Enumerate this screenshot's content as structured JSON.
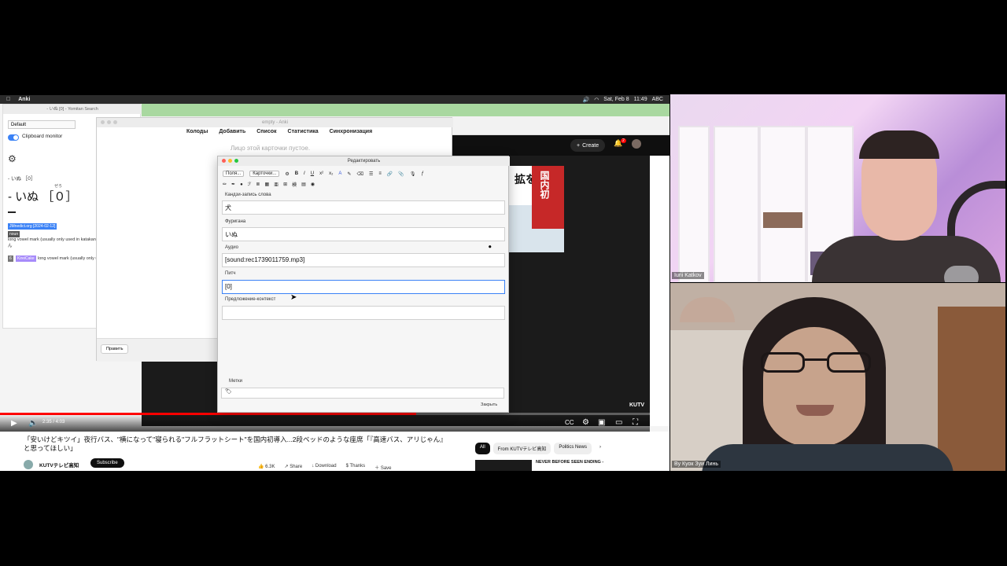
{
  "menubar": {
    "app": "Anki",
    "status_date": "Sat, Feb 8",
    "status_time": "11:49",
    "status_lang": "ABC"
  },
  "yandex": {
    "title": "- いぬ [0] - Yomitan Search",
    "profile": "Default",
    "clipboard_monitor": "Clipboard monitor",
    "small_term": "- いぬ ［0］",
    "big_term": "- いぬ  ［０］",
    "furigana": "ぜろ",
    "tag_dict": "JMnedict.org [2024-02-12]",
    "tag_pos": "noun",
    "definition1": "long vowel mark (usually only used in katakana) known as ちょうおん",
    "tag_kind": "6",
    "tag_source": "KireiCake",
    "definition2": "long vowel mark (usually only used in katakana)"
  },
  "browser": {
    "create_label": "Create",
    "notification_count": "2",
    "kutv": "KUTV",
    "thumb_text": "拡を ト",
    "thumb_text2": "国内初",
    "time": "2:35 / 4:03",
    "progress": 0.64,
    "video_title_line1": "「安いけどキツイ」夜行バス、\"横になって\"寝られる\"フルフラットシート\"を国内初導入...2段ベッドのような座席「『高速バス、アリじゃん』",
    "video_title_line2": "と思ってほしい」",
    "channel": "KUTVテレビ高知",
    "subscribe": "Subscribe",
    "likes": "6.3K",
    "share": "Share",
    "download": "Download",
    "thanks": "Thanks",
    "save": "Save",
    "chips": [
      "All",
      "From KUTVテレビ高知",
      "Politics News"
    ],
    "rec_title": "NEVER BEFORE SEEN ENDING -"
  },
  "anki": {
    "title": "empty - Anki",
    "nav": [
      "Колоды",
      "Добавить",
      "Список",
      "Статистика",
      "Синхронизация"
    ],
    "empty_msg": "Лицо этой карточки пустое.",
    "edit_btn": "Править"
  },
  "editor": {
    "title": "Редактировать",
    "fields_btn": "Поля...",
    "cards_btn": "Карточки...",
    "fields": [
      {
        "label": "Кандзи-запись слова",
        "value": "犬"
      },
      {
        "label": "Фуригана",
        "value": "いぬ"
      },
      {
        "label": "Аудио",
        "value": "[sound:rec1739011759.mp3]"
      },
      {
        "label": "Питч",
        "value": "[0]"
      },
      {
        "label": "Предложение-контекст",
        "value": ""
      }
    ],
    "tags_label": "Метки",
    "close_btn": "Закрыть"
  },
  "participants": {
    "p1": "Iurii Katkov",
    "p2": "Ву Куок Зуи Линь"
  }
}
